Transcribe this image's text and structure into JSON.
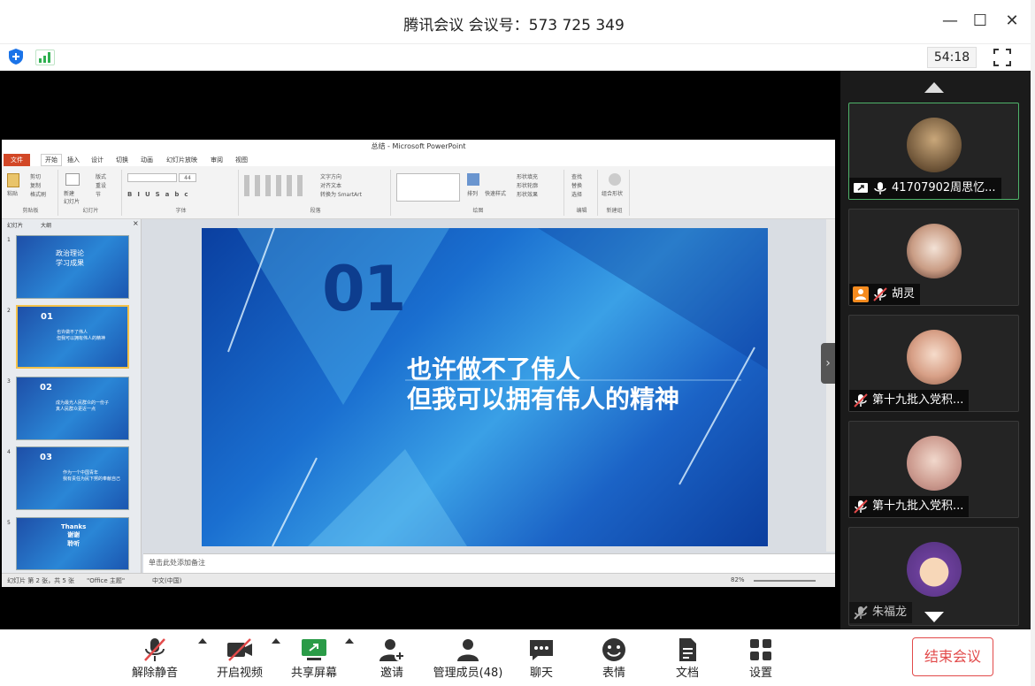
{
  "window": {
    "title": "腾讯会议 会议号：573 725 349",
    "minimize": "—",
    "maximize": "☐",
    "close": "✕"
  },
  "topbar": {
    "timer": "54:18"
  },
  "ppt": {
    "window_title": "总结 - Microsoft PowerPoint",
    "tabs": [
      "文件",
      "开始",
      "插入",
      "设计",
      "切换",
      "动画",
      "幻灯片放映",
      "审阅",
      "视图"
    ],
    "ribbon_groups": [
      "剪贴板",
      "幻灯片",
      "字体",
      "段落",
      "绘图",
      "编辑",
      "新建组"
    ],
    "ribbon_items": {
      "paste": "粘贴",
      "cut": "剪切",
      "copy": "复制",
      "format_painter": "格式刷",
      "new_slide": "新建\n幻灯片",
      "layout": "版式",
      "reset": "重设",
      "section": "节",
      "text_direction": "文字方向",
      "align_text": "对齐文本",
      "smartart": "转换为 SmartArt",
      "arrange": "排列",
      "quick_styles": "快速样式",
      "shape_fill": "形状填充",
      "shape_outline": "形状轮廓",
      "shape_effects": "形状效果",
      "find": "查找",
      "replace": "替换",
      "select": "选择",
      "group": "组合形状"
    },
    "panel_tabs": [
      "幻灯片",
      "大纲"
    ],
    "thumbnails": [
      {
        "num": "1",
        "title": "政治理论\n学习成果",
        "sub": ""
      },
      {
        "num": "2",
        "title": "01",
        "sub": "也许做不了伟人\n但我可以拥有伟人的精神"
      },
      {
        "num": "3",
        "title": "02",
        "sub": "成为最光人民群众的一份子\n真人民群众更近一点"
      },
      {
        "num": "4",
        "title": "03",
        "sub": "作为一个中国青年\n我有责任为民下努的奉献自己"
      },
      {
        "num": "5",
        "title": "Thanks\n谢谢\n聆听",
        "sub": ""
      }
    ],
    "slide": {
      "number": "01",
      "line1": "也许做不了伟人",
      "line2": "但我可以拥有伟人的精神"
    },
    "notes_placeholder": "单击此处添加备注",
    "status": {
      "slide_info": "幻灯片 第 2 张，共 5 张",
      "theme": "\"Office 主题\"",
      "language": "中文(中国)",
      "zoom": "82%"
    }
  },
  "participants": [
    {
      "name": "41707902周思忆...",
      "mic": "on",
      "sharing": true
    },
    {
      "name": "胡灵",
      "mic": "muted",
      "host": true
    },
    {
      "name": "第十九批入党积...",
      "mic": "muted"
    },
    {
      "name": "第十九批入党积...",
      "mic": "muted"
    },
    {
      "name": "朱福龙",
      "mic": "muted"
    }
  ],
  "toolbar": {
    "mute": "解除静音",
    "video": "开启视频",
    "share": "共享屏幕",
    "invite": "邀请",
    "members": "管理成员(48)",
    "chat": "聊天",
    "emoji": "表情",
    "docs": "文档",
    "settings": "设置",
    "end": "结束会议"
  },
  "colors": {
    "end_red": "#e24a4a",
    "active_green": "#4fb36a",
    "slide_blue": "#1a6fd0"
  }
}
